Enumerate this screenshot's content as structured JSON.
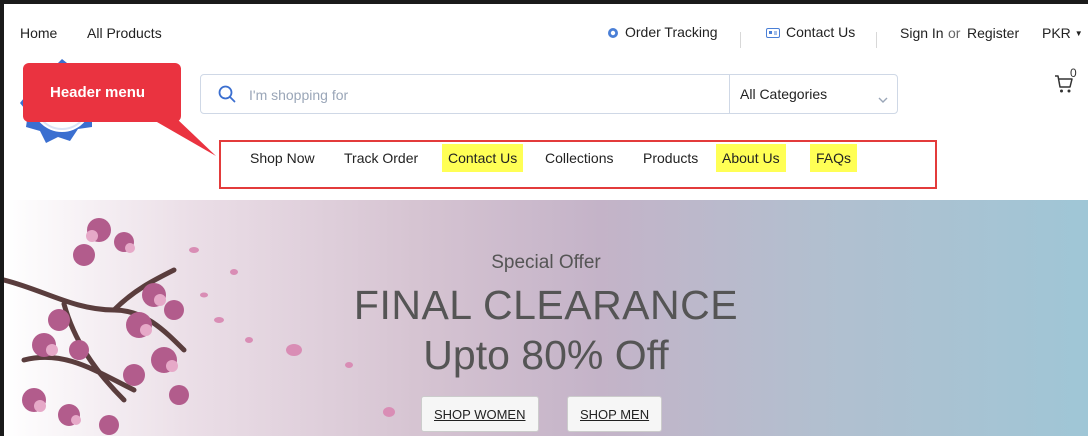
{
  "topbar": {
    "home": "Home",
    "all_products": "All Products",
    "order_tracking": "Order Tracking",
    "contact_us": "Contact Us",
    "sign_in": "Sign In",
    "or": "or",
    "register": "Register",
    "currency": "PKR"
  },
  "search": {
    "placeholder": "I'm shopping for",
    "category": "All Categories"
  },
  "cart": {
    "count": "0"
  },
  "callout": {
    "label": "Header menu"
  },
  "menu": {
    "items": [
      {
        "label": "Shop Now",
        "highlighted": false
      },
      {
        "label": "Track Order",
        "highlighted": false
      },
      {
        "label": "Contact Us",
        "highlighted": true
      },
      {
        "label": "Collections",
        "highlighted": false
      },
      {
        "label": "Products",
        "highlighted": false
      },
      {
        "label": "About Us",
        "highlighted": true
      },
      {
        "label": "FAQs",
        "highlighted": true
      }
    ]
  },
  "banner": {
    "kicker": "Special Offer",
    "title": "FINAL CLEARANCE",
    "subtitle": "Upto 80% Off",
    "button_women": "SHOP WOMEN",
    "button_men": "SHOP MEN"
  },
  "colors": {
    "highlight": "#ffff55",
    "annotation_red": "#e33b3b",
    "callout_red": "#ea3340"
  }
}
